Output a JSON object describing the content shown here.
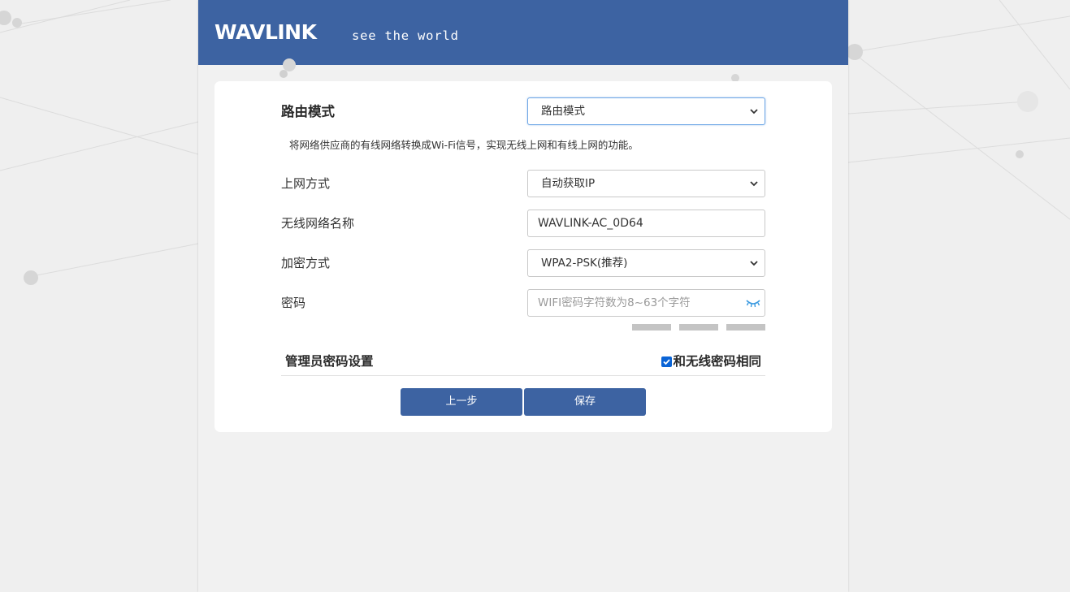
{
  "header": {
    "logo": "WAVLINK",
    "tagline": "see the world"
  },
  "mode": {
    "label": "路由模式",
    "selected": "路由模式",
    "description": "将网络供应商的有线网络转换成Wi-Fi信号，实现无线上网和有线上网的功能。"
  },
  "internet": {
    "label": "上网方式",
    "selected": "自动获取IP"
  },
  "ssid": {
    "label": "无线网络名称",
    "value": "WAVLINK-AC_0D64"
  },
  "encryption": {
    "label": "加密方式",
    "selected": "WPA2-PSK(推荐)"
  },
  "password": {
    "label": "密码",
    "placeholder": "WIFI密码字符数为8~63个字符",
    "strength_levels_filled": 0
  },
  "admin": {
    "label": "管理员密码设置",
    "same_label": "和无线密码相同",
    "same_checked": true
  },
  "buttons": {
    "prev": "上一步",
    "save": "保存"
  },
  "colors": {
    "brand": "#3d63a2",
    "checkbox": "#0a64d6",
    "eye_icon": "#3b9ae0"
  },
  "icons": {
    "select_arrow": "chevron-down-icon",
    "password_toggle": "eye-closed-icon",
    "checkbox": "checkmark-icon"
  }
}
